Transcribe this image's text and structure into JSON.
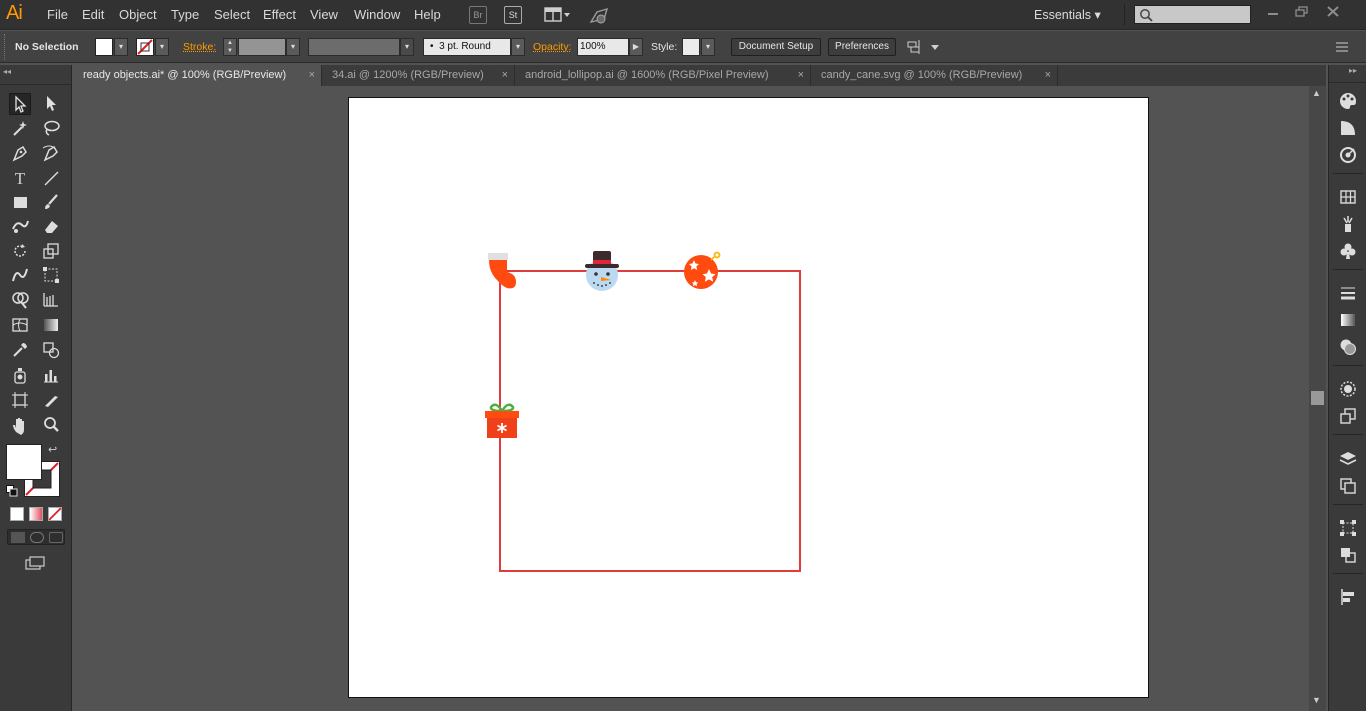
{
  "app": {
    "logo": "Ai"
  },
  "menu": [
    "File",
    "Edit",
    "Object",
    "Type",
    "Select",
    "Effect",
    "View",
    "Window",
    "Help"
  ],
  "menu_buttons": {
    "bridge": "Br",
    "stock": "St"
  },
  "workspace": {
    "label": "Essentials",
    "chevron": "▾"
  },
  "control": {
    "selection": "No Selection",
    "stroke_label": "Stroke:",
    "brush_value": "3 pt. Round",
    "opacity_label": "Opacity:",
    "opacity_value": "100%",
    "style_label": "Style:",
    "document_setup": "Document Setup",
    "preferences": "Preferences"
  },
  "tabs": [
    {
      "label": "ready objects.ai* @ 100% (RGB/Preview)",
      "close": "×"
    },
    {
      "label": "34.ai @ 1200% (RGB/Preview)",
      "close": "×"
    },
    {
      "label": "android_lollipop.ai @ 1600% (RGB/Pixel Preview)",
      "close": "×"
    },
    {
      "label": "candy_cane.svg @ 100% (RGB/Preview)",
      "close": "×"
    }
  ],
  "colors": {
    "accent": "#ff9a00",
    "frame": "#e23b3b",
    "ornament": "#ff4500"
  }
}
